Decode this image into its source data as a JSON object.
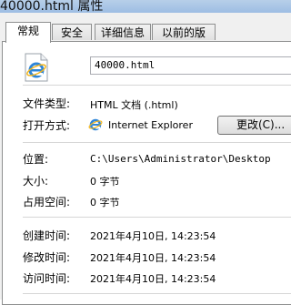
{
  "window": {
    "title": "40000.html 属性"
  },
  "tabs": [
    "常规",
    "安全",
    "详细信息",
    "以前的版本"
  ],
  "file": {
    "name": "40000.html"
  },
  "props": {
    "type_label": "文件类型:",
    "type_value": "HTML 文档 (.html)",
    "open_with_label": "打开方式:",
    "open_with_value": "Internet Explorer",
    "change_button": "更改(C)...",
    "location_label": "位置:",
    "location_value": "C:\\Users\\Administrator\\Desktop",
    "size_label": "大小:",
    "size_value": "0 字节",
    "disk_size_label": "占用空间:",
    "disk_size_value": "0 字节",
    "created_label": "创建时间:",
    "created_value": "2021年4月10日, 14:23:54",
    "modified_label": "修改时间:",
    "modified_value": "2021年4月10日, 14:23:54",
    "accessed_label": "访问时间:",
    "accessed_value": "2021年4月10日, 14:23:54"
  },
  "icons": {
    "file_icon": "ie-html-file-icon",
    "app_icon": "internet-explorer-icon"
  }
}
